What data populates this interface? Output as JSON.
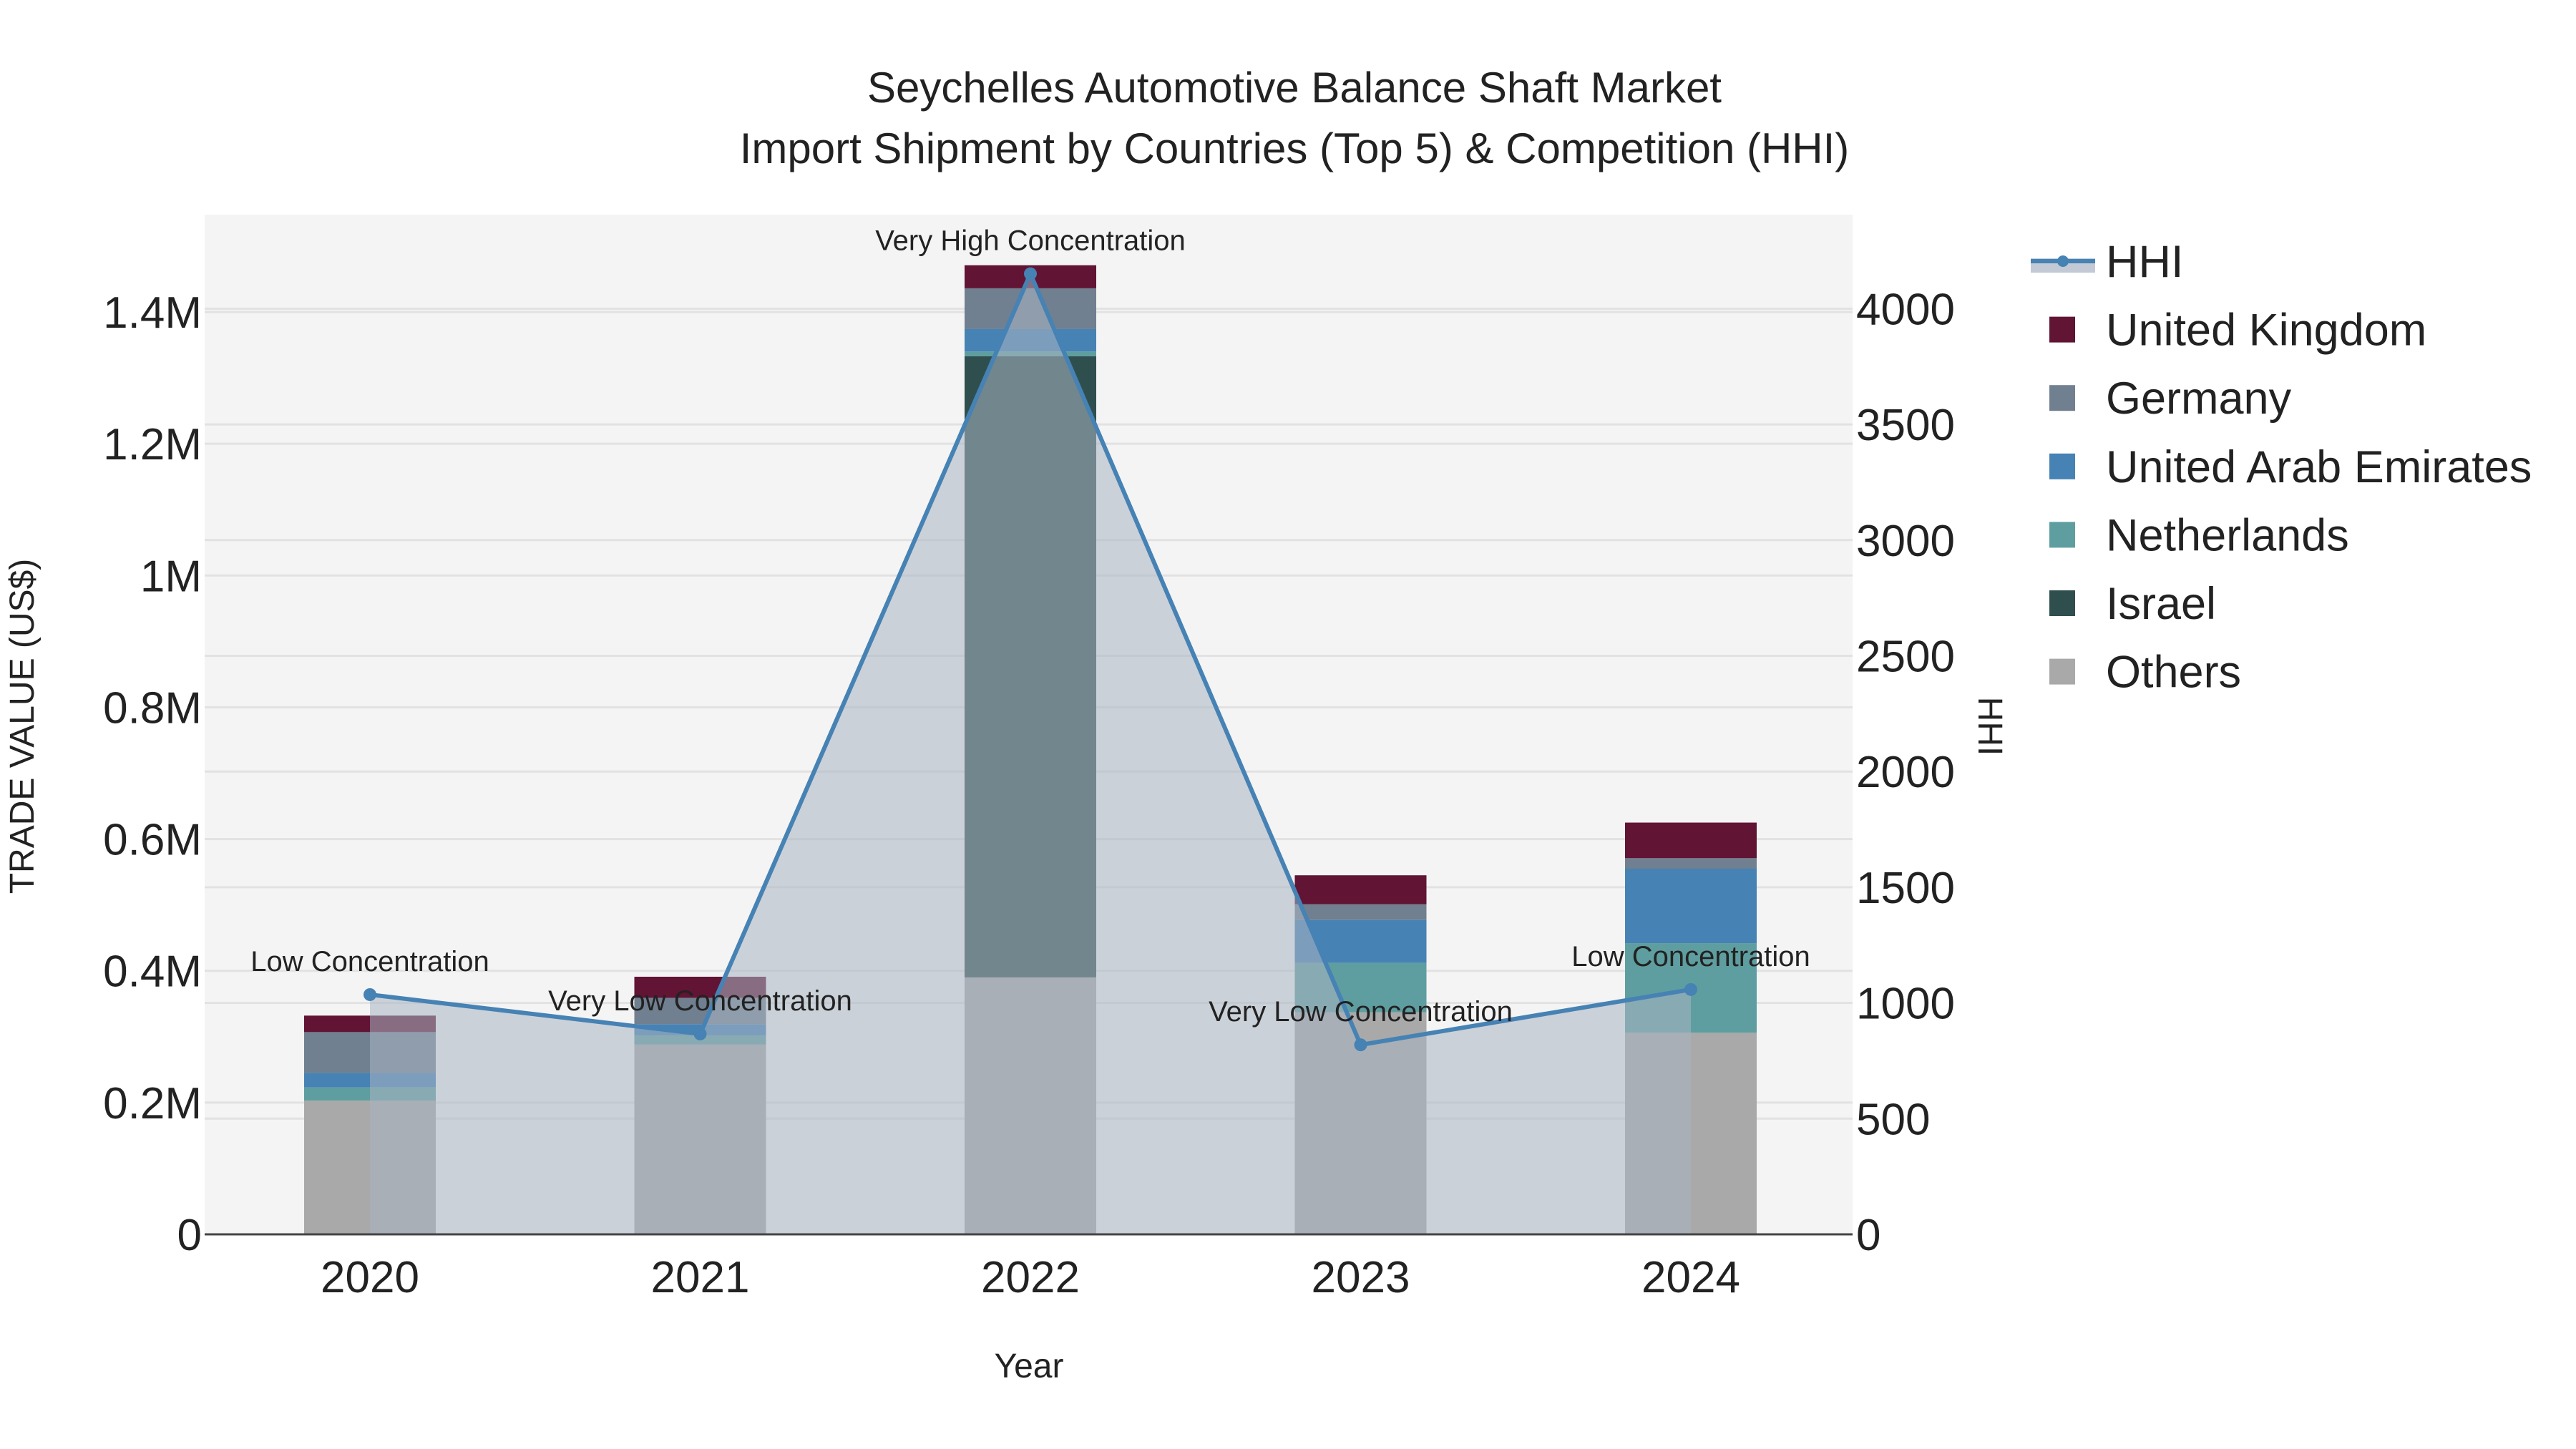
{
  "chart_data": {
    "type": "bar",
    "title": "Seychelles Automotive Balance Shaft Market",
    "subtitle": "Import Shipment by Countries (Top 5) & Competition (HHI)",
    "xlabel": "Year",
    "ylabel": "TRADE VALUE (US$)",
    "y2label": "HHI",
    "categories": [
      "2020",
      "2021",
      "2022",
      "2023",
      "2024"
    ],
    "ylim": [
      0,
      1550000
    ],
    "y2lim": [
      0,
      4400
    ],
    "yticks": [
      0,
      200000,
      400000,
      600000,
      800000,
      1000000,
      1200000,
      1400000
    ],
    "ytick_labels": [
      "0",
      "0.2M",
      "0.4M",
      "0.6M",
      "0.8M",
      "1M",
      "1.2M",
      "1.4M"
    ],
    "y2ticks": [
      0,
      500,
      1000,
      1500,
      2000,
      2500,
      3000,
      3500,
      4000
    ],
    "y2tick_labels": [
      "0",
      "500",
      "1000",
      "1500",
      "2000",
      "2500",
      "3000",
      "3500",
      "4000"
    ],
    "stacked": true,
    "series": [
      {
        "name": "Others",
        "color": "#a9a9a9",
        "values": [
          203000,
          288000,
          390000,
          337000,
          306000
        ]
      },
      {
        "name": "Israel",
        "color": "#2f4f4f",
        "values": [
          0,
          0,
          943000,
          0,
          0
        ]
      },
      {
        "name": "Netherlands",
        "color": "#5f9ea0",
        "values": [
          20000,
          14000,
          7000,
          75000,
          136000
        ]
      },
      {
        "name": "United Arab Emirates",
        "color": "#4682b4",
        "values": [
          22000,
          17000,
          34000,
          65000,
          113000
        ]
      },
      {
        "name": "Germany",
        "color": "#708090",
        "values": [
          62000,
          40000,
          62000,
          24000,
          16000
        ]
      },
      {
        "name": "United Kingdom",
        "color": "#611434",
        "values": [
          25000,
          32000,
          35000,
          44000,
          54000
        ]
      }
    ],
    "line_series": {
      "name": "HHI",
      "color": "#4682b4",
      "axis": "right",
      "values": [
        1036,
        866,
        4151,
        819,
        1058
      ],
      "annotations": [
        "Low Concentration",
        "Very Low Concentration",
        "Very High Concentration",
        "Very Low Concentration",
        "Low Concentration"
      ]
    },
    "legend": {
      "placement": "right",
      "entries": [
        "HHI",
        "United Kingdom",
        "Germany",
        "United Arab Emirates",
        "Netherlands",
        "Israel",
        "Others"
      ]
    },
    "grid": true
  }
}
